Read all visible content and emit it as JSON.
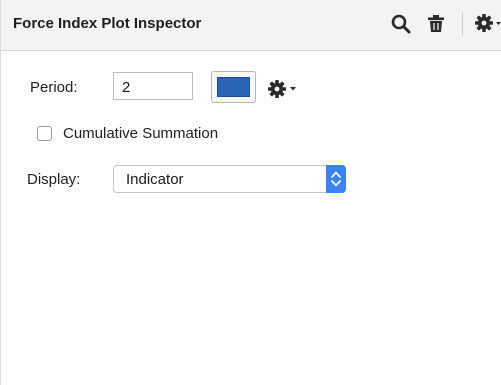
{
  "inspector": {
    "title": "Force Index Plot Inspector",
    "header_icons": [
      "search-icon",
      "trash-icon",
      "gear-icon"
    ]
  },
  "form": {
    "period_label": "Period:",
    "period_value": "2",
    "line_color": "#2b63b5",
    "style_menu_icon": "gear-icon",
    "cumulative_label": "Cumulative Summation",
    "cumulative_checked": false,
    "display_label": "Display:",
    "display_value": "Indicator"
  },
  "colors": {
    "accent": "#3b82f7",
    "header_background": "#f3f3f3"
  }
}
